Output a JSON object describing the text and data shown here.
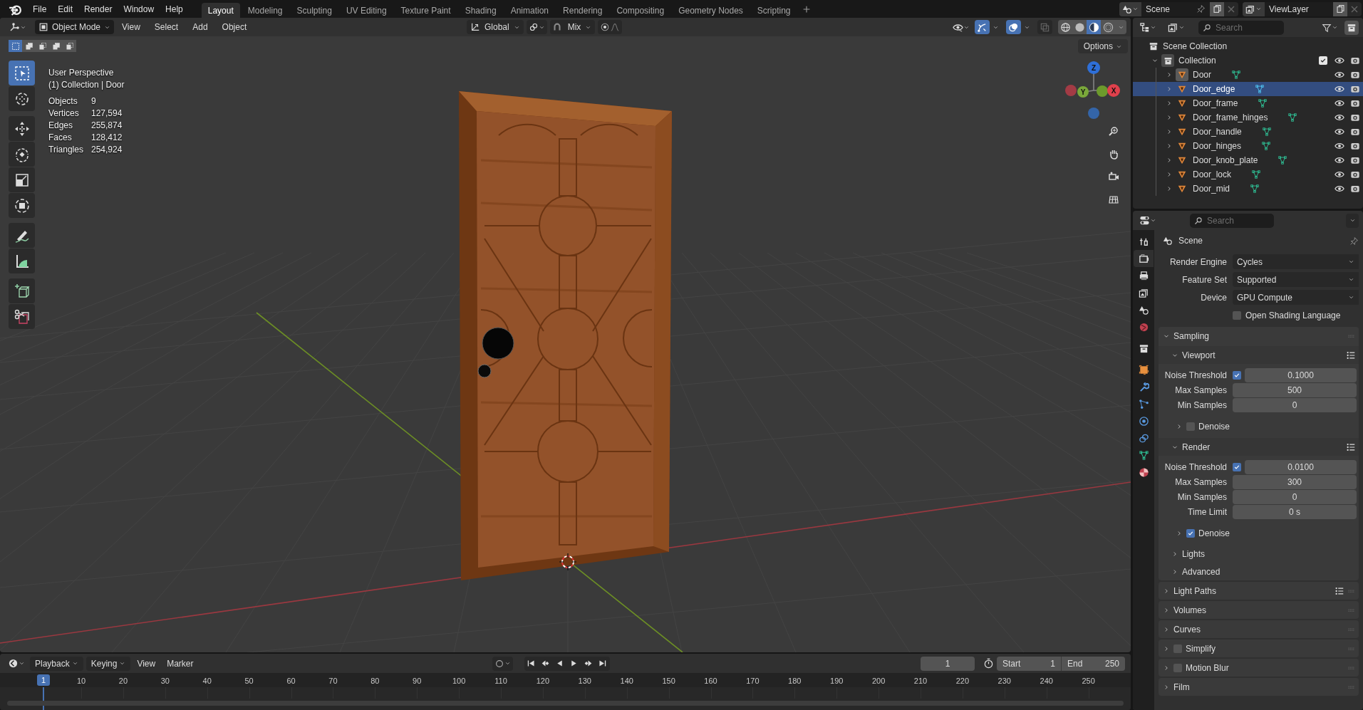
{
  "top_menu": [
    "File",
    "Edit",
    "Render",
    "Window",
    "Help"
  ],
  "workspace_tabs": [
    {
      "label": "Layout",
      "selected": true
    },
    {
      "label": "Modeling",
      "selected": false
    },
    {
      "label": "Sculpting",
      "selected": false
    },
    {
      "label": "UV Editing",
      "selected": false
    },
    {
      "label": "Texture Paint",
      "selected": false
    },
    {
      "label": "Shading",
      "selected": false
    },
    {
      "label": "Animation",
      "selected": false
    },
    {
      "label": "Rendering",
      "selected": false
    },
    {
      "label": "Compositing",
      "selected": false
    },
    {
      "label": "Geometry Nodes",
      "selected": false
    },
    {
      "label": "Scripting",
      "selected": false
    }
  ],
  "scene": {
    "name": "Scene"
  },
  "view_layer": {
    "name": "ViewLayer"
  },
  "viewport": {
    "mode": "Object Mode",
    "menus": [
      "View",
      "Select",
      "Add",
      "Object"
    ],
    "orientation": "Global",
    "snapping": "Mix",
    "options": "Options",
    "gizmos_on": true,
    "overlays_on": true,
    "select_modes": [
      {
        "selected": true
      },
      {
        "selected": false
      },
      {
        "selected": false
      },
      {
        "selected": false
      },
      {
        "selected": false
      }
    ],
    "shading_modes": [
      {
        "kind": "wireframe",
        "selected": false
      },
      {
        "kind": "solid",
        "selected": false
      },
      {
        "kind": "material",
        "selected": true
      },
      {
        "kind": "rendered",
        "selected": false
      }
    ],
    "tools": [
      {
        "kind": "select_box",
        "selected": true
      },
      {
        "kind": "cursor",
        "selected": false
      },
      {
        "kind": "move",
        "selected": false
      },
      {
        "kind": "rotate",
        "selected": false
      },
      {
        "kind": "scale",
        "selected": false
      },
      {
        "kind": "transform",
        "selected": false
      },
      {
        "kind": "annotate",
        "selected": false
      },
      {
        "kind": "measure",
        "selected": false
      },
      {
        "kind": "add_cube",
        "selected": false
      },
      {
        "kind": "cut",
        "selected": false
      }
    ],
    "title": "User Perspective",
    "context": "(1) Collection | Door",
    "stats": [
      {
        "label": "Objects",
        "value": "9"
      },
      {
        "label": "Vertices",
        "value": "127,594"
      },
      {
        "label": "Edges",
        "value": "255,874"
      },
      {
        "label": "Faces",
        "value": "128,412"
      },
      {
        "label": "Triangles",
        "value": "254,924"
      }
    ],
    "gizmo": {
      "z": "Z",
      "y": "Y",
      "x": "X"
    }
  },
  "outliner": {
    "search_placeholder": "Search",
    "root": "Scene Collection",
    "collection": {
      "label": "Collection",
      "expanded": true,
      "checked": true,
      "children": [
        {
          "label": "Door",
          "selected": false,
          "active": true,
          "expanded": false
        },
        {
          "label": "Door_edge",
          "selected": true,
          "active": false,
          "expanded": false
        },
        {
          "label": "Door_frame",
          "selected": false,
          "active": false,
          "expanded": false
        },
        {
          "label": "Door_frame_hinges",
          "selected": false,
          "active": false,
          "expanded": false
        },
        {
          "label": "Door_handle",
          "selected": false,
          "active": false,
          "expanded": false
        },
        {
          "label": "Door_hinges",
          "selected": false,
          "active": false,
          "expanded": false
        },
        {
          "label": "Door_knob_plate",
          "selected": false,
          "active": false,
          "expanded": false
        },
        {
          "label": "Door_lock",
          "selected": false,
          "active": false,
          "expanded": false
        },
        {
          "label": "Door_mid",
          "selected": false,
          "active": false,
          "expanded": false
        }
      ]
    }
  },
  "properties": {
    "search_placeholder": "Search",
    "context": "Scene",
    "tabs": [
      {
        "kind": "tool",
        "selected": false
      },
      {
        "kind": "render",
        "selected": true
      },
      {
        "kind": "output",
        "selected": false
      },
      {
        "kind": "view_layer",
        "selected": false
      },
      {
        "kind": "scene",
        "selected": false
      },
      {
        "kind": "world",
        "selected": false
      },
      {
        "kind": "collection",
        "selected": false
      },
      {
        "kind": "object",
        "selected": false
      },
      {
        "kind": "modifiers",
        "selected": false
      },
      {
        "kind": "particles",
        "selected": false
      },
      {
        "kind": "physics",
        "selected": false
      },
      {
        "kind": "constraints",
        "selected": false
      },
      {
        "kind": "data",
        "selected": false
      },
      {
        "kind": "material",
        "selected": false
      }
    ],
    "fields": [
      {
        "label": "Render Engine",
        "value": "Cycles"
      },
      {
        "label": "Feature Set",
        "value": "Supported"
      },
      {
        "label": "Device",
        "value": "GPU Compute"
      }
    ],
    "osl": {
      "label": "Open Shading Language",
      "checked": false
    },
    "panels": [
      {
        "label": "Sampling",
        "expanded": true,
        "children": [
          {
            "label": "Viewport",
            "expanded": true,
            "presets": true,
            "rows": [
              {
                "kind": "toggle_number",
                "label": "Noise Threshold",
                "checked": true,
                "value": "0.1000"
              },
              {
                "kind": "number",
                "label": "Max Samples",
                "value": "500"
              },
              {
                "kind": "number",
                "label": "Min Samples",
                "value": "0"
              }
            ],
            "children": [
              {
                "label": "Denoise",
                "expanded": false,
                "checked": false
              }
            ]
          },
          {
            "label": "Render",
            "expanded": true,
            "presets": true,
            "rows": [
              {
                "kind": "toggle_number",
                "label": "Noise Threshold",
                "checked": true,
                "value": "0.0100"
              },
              {
                "kind": "number",
                "label": "Max Samples",
                "value": "300"
              },
              {
                "kind": "number",
                "label": "Min Samples",
                "value": "0"
              },
              {
                "kind": "number",
                "label": "Time Limit",
                "value": "0 s"
              }
            ],
            "children": [
              {
                "label": "Denoise",
                "expanded": false,
                "checked": true
              }
            ]
          },
          {
            "label": "Lights",
            "expanded": false
          },
          {
            "label": "Advanced",
            "expanded": false
          }
        ]
      },
      {
        "label": "Light Paths",
        "expanded": false,
        "presets": true
      },
      {
        "label": "Volumes",
        "expanded": false
      },
      {
        "label": "Curves",
        "expanded": false
      },
      {
        "label": "Simplify",
        "expanded": false,
        "checked": false
      },
      {
        "label": "Motion Blur",
        "expanded": false,
        "checked": false
      },
      {
        "label": "Film",
        "expanded": false
      }
    ]
  },
  "timeline": {
    "menus": [
      {
        "label": "Playback",
        "dropdown": true
      },
      {
        "label": "Keying",
        "dropdown": true
      },
      {
        "label": "View",
        "dropdown": false
      },
      {
        "label": "Marker",
        "dropdown": false
      }
    ],
    "current_frame": "1",
    "start_label": "Start",
    "start": "1",
    "end_label": "End",
    "end": "250",
    "playhead": "1",
    "ticks": [
      "10",
      "20",
      "30",
      "40",
      "50",
      "60",
      "70",
      "80",
      "90",
      "100",
      "110",
      "120",
      "130",
      "140",
      "150",
      "160",
      "170",
      "180",
      "190",
      "200",
      "210",
      "220",
      "230",
      "240",
      "250"
    ]
  }
}
